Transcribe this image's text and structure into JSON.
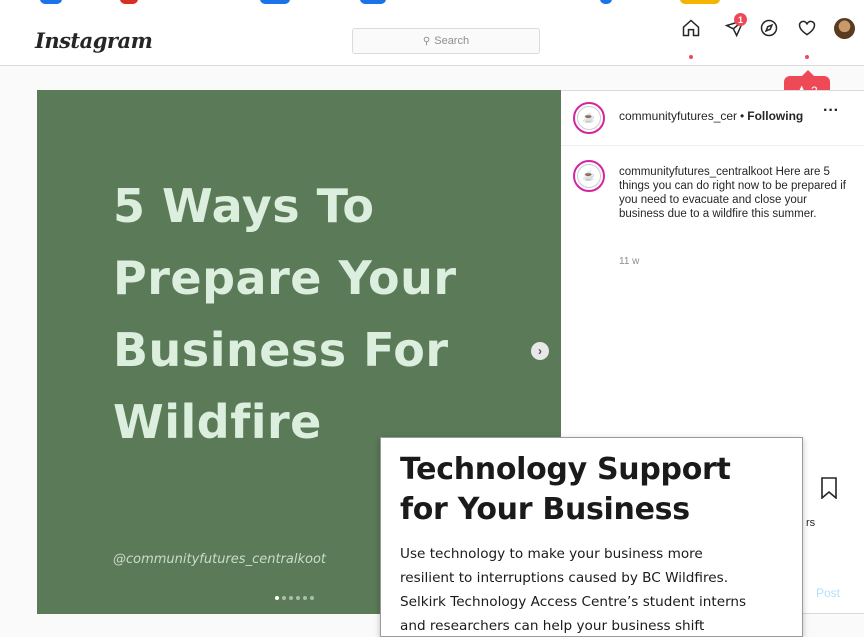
{
  "app": {
    "logo": "Instagram",
    "search_placeholder": "Search"
  },
  "nav": {
    "icons": [
      "home-icon",
      "direct-message-icon",
      "explore-icon",
      "activity-heart-icon",
      "profile-avatar-icon"
    ],
    "direct_badge": "1",
    "activity_tooltip_count": "2",
    "accent": "#ed4956"
  },
  "post": {
    "image": {
      "headline_lines": [
        "5 Ways To",
        "Prepare Your",
        "Business For",
        "Wildfire"
      ],
      "handle": "@communityfutures_centralkoot",
      "background": "#5a7a58",
      "carousel_total": 6,
      "carousel_active": 1
    },
    "header": {
      "username": "communityfutures_cer",
      "separator": "•",
      "follow_state": "Following",
      "more": "···"
    },
    "caption": {
      "username": "communityfutures_centralkoot",
      "text": "Here are 5 things you can do right now to be prepared if you need to evacuate and close your business due to a wildfire this summer.",
      "time": "11 w"
    },
    "actions": {
      "partial_text": "rs",
      "post_button": "Post"
    }
  },
  "overlay_card": {
    "title_lines": [
      "Technology Support",
      "for Your Business"
    ],
    "body_lines": [
      "Use technology to make your business more",
      "resilient to interruptions caused by BC Wildfires.",
      "Selkirk Technology Access Centre’s student interns",
      "and researchers can help your business shift"
    ]
  }
}
